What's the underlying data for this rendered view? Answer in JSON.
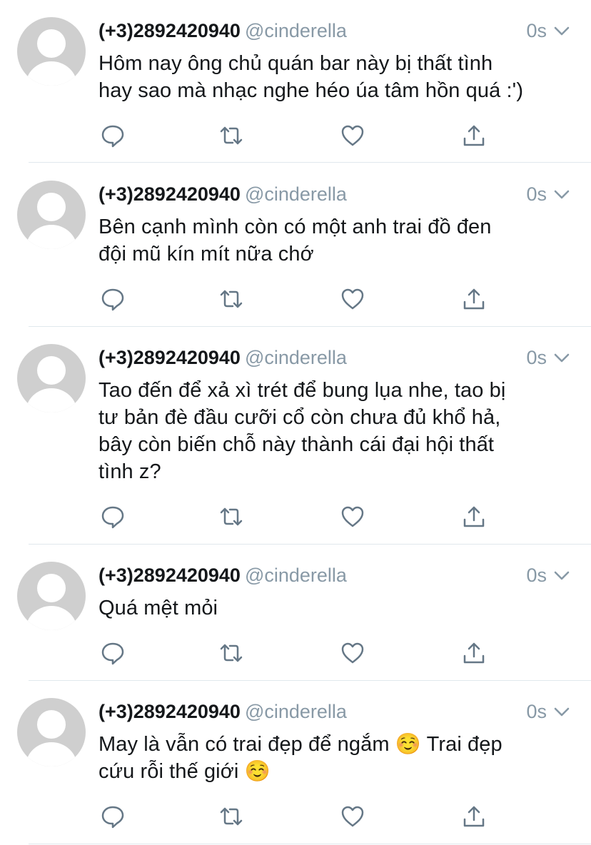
{
  "tweets": [
    {
      "name": "(+3)2892420940",
      "handle": "@cinderella",
      "time": "0s",
      "lines": [
        "Hôm nay ông chủ quán bar này bị thất tình",
        "hay sao mà nhạc nghe héo úa tâm hồn quá :')"
      ]
    },
    {
      "name": "(+3)2892420940",
      "handle": "@cinderella",
      "time": "0s",
      "lines": [
        "Bên cạnh mình còn có một anh trai đồ đen",
        "đội mũ kín mít nữa chớ"
      ]
    },
    {
      "name": "(+3)2892420940",
      "handle": "@cinderella",
      "time": "0s",
      "lines": [
        "Tao đến để xả xì trét để bung lụa nhe, tao bị",
        "tư bản đè đầu cưỡi cổ còn chưa đủ khổ hả,",
        "bây còn biến chỗ này thành cái đại hội thất",
        "tình z?"
      ]
    },
    {
      "name": "(+3)2892420940",
      "handle": "@cinderella",
      "time": "0s",
      "lines": [
        "Quá mệt mỏi"
      ]
    },
    {
      "name": "(+3)2892420940",
      "handle": "@cinderella",
      "time": "0s",
      "lines": [
        "May là vẫn có trai đẹp để ngắm ☺️ Trai đẹp",
        "cứu rỗi thế giới ☺️"
      ]
    }
  ],
  "icons": {
    "reply": "reply-icon",
    "retweet": "retweet-icon",
    "like": "heart-icon",
    "share": "share-icon",
    "menu": "chevron-down-icon",
    "avatar": "default-avatar-icon"
  },
  "colors": {
    "text": "#14171a",
    "muted": "#8899a6",
    "icon": "#657786",
    "avatar_bg": "#cfcfcf",
    "divider": "#e1e8ed"
  }
}
